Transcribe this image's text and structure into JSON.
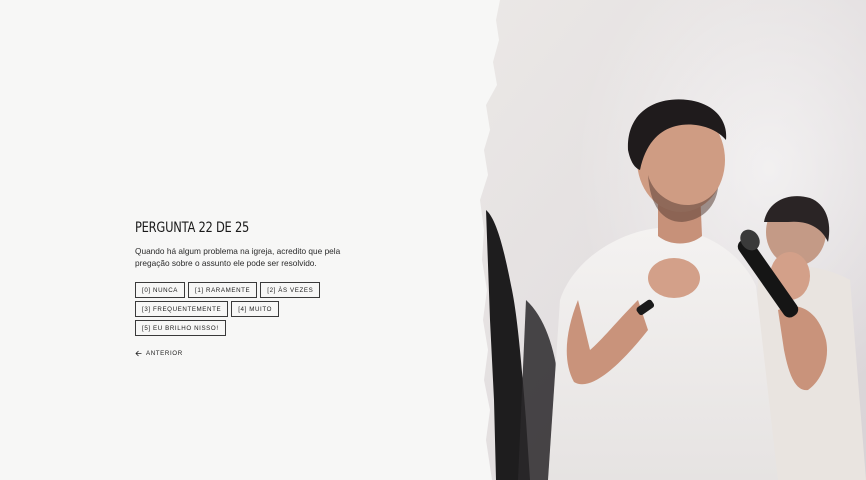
{
  "question": {
    "title": "PERGUNTA 22 DE 25",
    "text": "Quando há algum problema na igreja, acredito que pela pregação sobre o assunto ele pode ser resolvido."
  },
  "options": [
    {
      "label": "[0] NUNCA"
    },
    {
      "label": "[1] RARAMENTE"
    },
    {
      "label": "[2] ÀS VEZES"
    },
    {
      "label": "[3] FREQUENTEMENTE"
    },
    {
      "label": "[4] MUITO"
    },
    {
      "label": "[5] EU BRILHO NISSO!"
    }
  ],
  "nav": {
    "back_label": "ANTERIOR",
    "back_icon": "arrow-left-icon"
  },
  "colors": {
    "background": "#f7f7f6",
    "text": "#1a1a1a",
    "border": "#3a3a3a"
  }
}
